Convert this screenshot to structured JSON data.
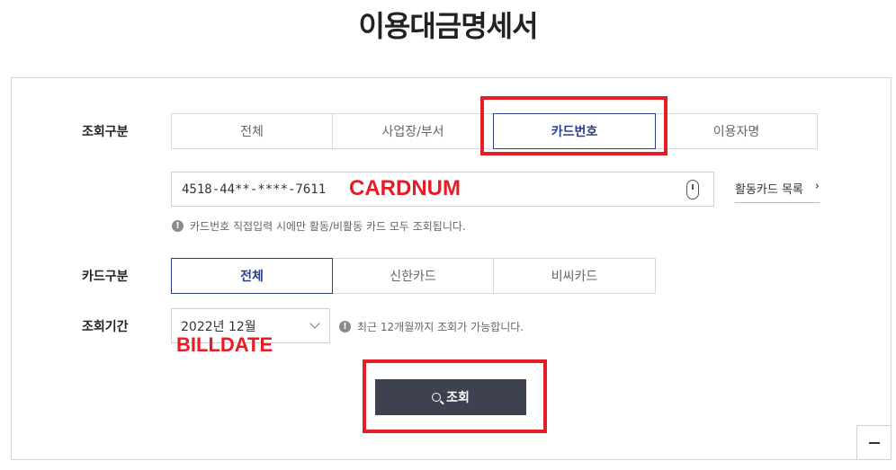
{
  "page_title": "이용대금명세서",
  "query_type": {
    "label": "조회구분",
    "options": [
      "전체",
      "사업장/부서",
      "카드번호",
      "이용자명"
    ],
    "selected": "카드번호"
  },
  "card_number": {
    "value": "4518-44**-****-7611",
    "active_cards_link": "활동카드 목록",
    "notice": "카드번호 직접입력 시에만 활동/비활동 카드 모두 조회됩니다."
  },
  "card_type": {
    "label": "카드구분",
    "options": [
      "전체",
      "신한카드",
      "비씨카드"
    ],
    "selected": "전체"
  },
  "period": {
    "label": "조회기간",
    "value": "2022년 12월",
    "notice": "최근 12개월까지 조회가 가능합니다."
  },
  "search_button": "조회",
  "annotations": {
    "cardnum": "CARDNUM",
    "billdate": "BILLDATE",
    "color": "#e41e26"
  },
  "colors": {
    "active_border": "#2b3f87",
    "search_button_bg": "#3d4150"
  },
  "icons": [
    "keypad-icon",
    "info-icon",
    "search-icon",
    "chevron-right-icon",
    "chevron-down-icon",
    "minus-icon"
  ]
}
